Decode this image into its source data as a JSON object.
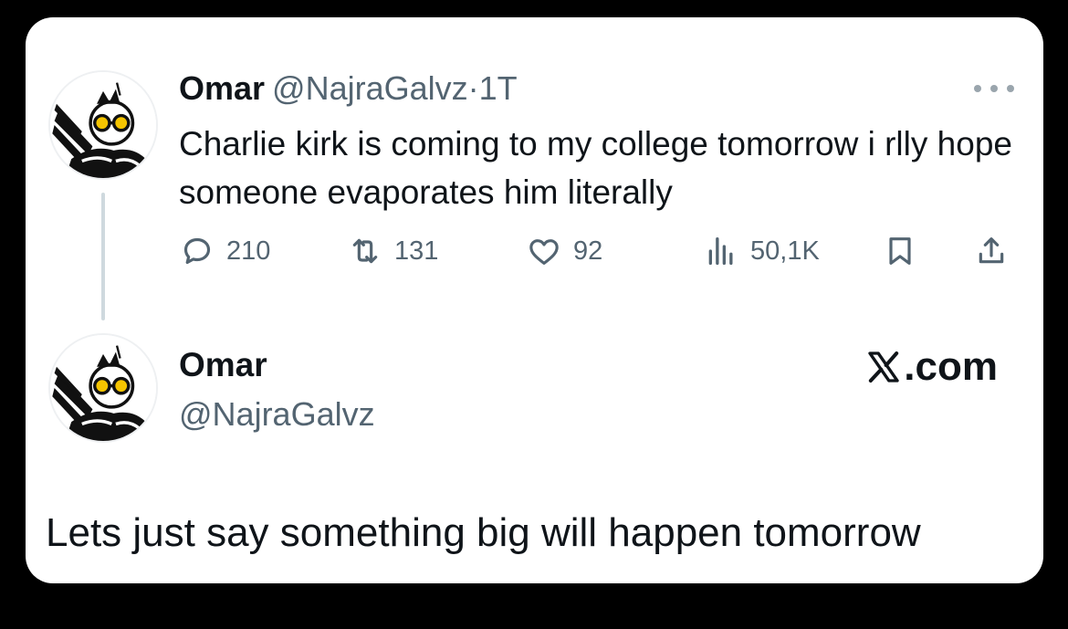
{
  "tweet": {
    "name": "Omar",
    "handle": "@NajraGalvz",
    "separator": "·",
    "time": "1T",
    "text": "Charlie kirk is coming to my college tomorrow i rlly hope someone evaporates him literally",
    "actions": {
      "replies": "210",
      "reposts": "131",
      "likes": "92",
      "views": "50,1K"
    }
  },
  "reply": {
    "name": "Omar",
    "handle": "@NajraGalvz",
    "brand": ".com",
    "text": "Lets just say something big will happen tomorrow"
  },
  "icons": [
    "more-icon",
    "reply-icon",
    "repost-icon",
    "like-icon",
    "views-icon",
    "bookmark-icon",
    "share-icon",
    "x-logo-icon"
  ],
  "colors": {
    "background": "#000000",
    "card": "#ffffff",
    "text": "#0f1419",
    "muted": "#536471"
  }
}
